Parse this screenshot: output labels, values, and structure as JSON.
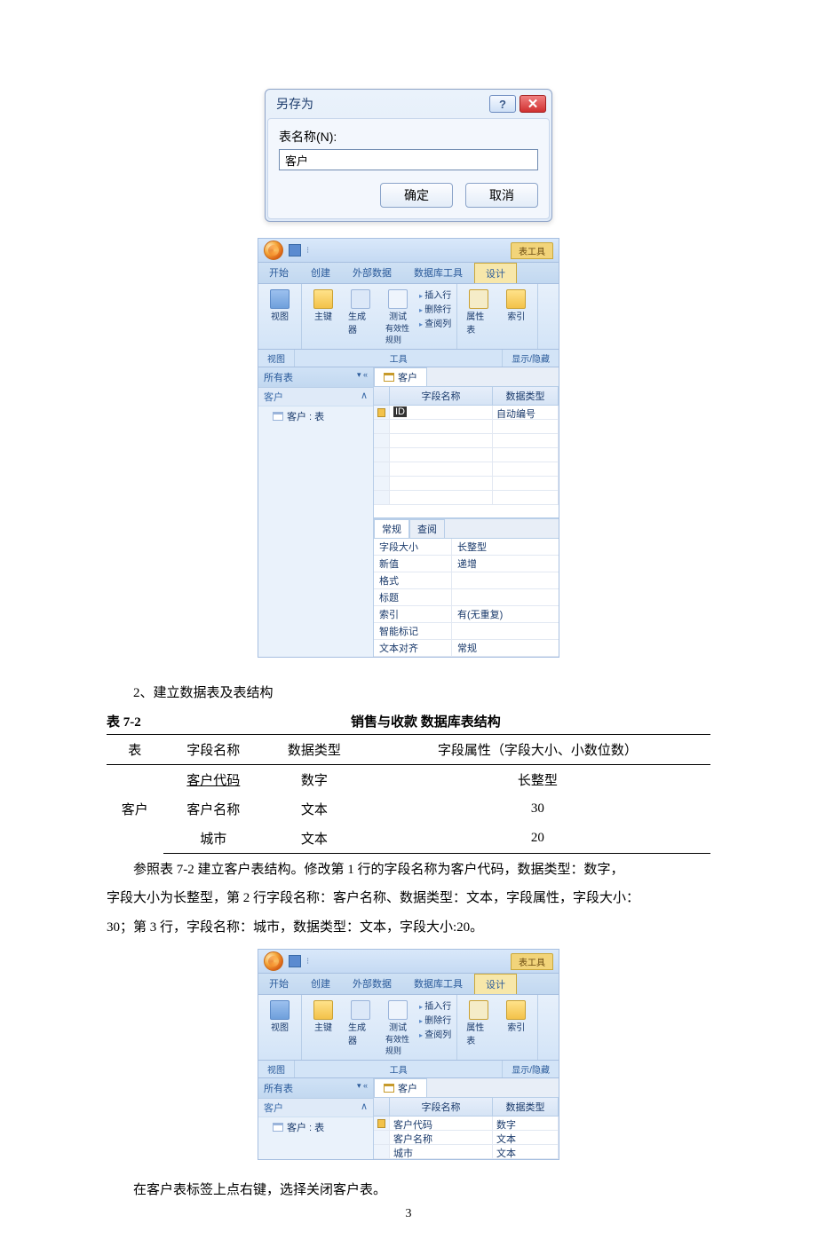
{
  "saveas": {
    "title": "另存为",
    "label": "表名称(N):",
    "value": "客户",
    "ok": "确定",
    "cancel": "取消"
  },
  "access1": {
    "context": "表工具",
    "tabs": {
      "start": "开始",
      "create": "创建",
      "external": "外部数据",
      "dbtools": "数据库工具",
      "design": "设计"
    },
    "ribbon": {
      "view": "视图",
      "key": "主键",
      "builder": "生成器",
      "test": "测试",
      "valid": "有效性规则",
      "insert": "插入行",
      "delete": "删除行",
      "lookup": "查阅列",
      "prop": "属性表",
      "index": "索引",
      "g_view": "视图",
      "g_tools": "工具",
      "g_show": "显示/隐藏"
    },
    "nav": {
      "all": "所有表",
      "group": "客户",
      "item": "客户 : 表"
    },
    "design": {
      "tab": "客户",
      "head_field": "字段名称",
      "head_type": "数据类型",
      "row1_field": "ID",
      "row1_type": "自动编号",
      "proptab1": "常规",
      "proptab2": "查阅",
      "props": [
        {
          "k": "字段大小",
          "v": "长整型"
        },
        {
          "k": "新值",
          "v": "递增"
        },
        {
          "k": "格式",
          "v": ""
        },
        {
          "k": "标题",
          "v": ""
        },
        {
          "k": "索引",
          "v": "有(无重复)"
        },
        {
          "k": "智能标记",
          "v": ""
        },
        {
          "k": "文本对齐",
          "v": "常规"
        }
      ]
    }
  },
  "doc": {
    "step2": "2、建立数据表及表结构",
    "tbl_num": "表 7-2",
    "tbl_title": "销售与收款 数据库表结构",
    "th": {
      "tbl": "表",
      "field": "字段名称",
      "type": "数据类型",
      "attr": "字段属性（字段大小、小数位数）"
    },
    "rows": {
      "name": "客户",
      "r1f": "客户代码",
      "r1t": "数字",
      "r1a": "长整型",
      "r2f": "客户名称",
      "r2t": "文本",
      "r2a": "30",
      "r3f": "城市",
      "r3t": "文本",
      "r3a": "20"
    },
    "para1": "参照表 7-2 建立客户表结构。修改第 1 行的字段名称为客户代码，数据类型：数字，",
    "para2": "字段大小为长整型，第 2 行字段名称：客户名称、数据类型：文本，字段属性，字段大小：",
    "para3": "30；第 3 行，字段名称：城市，数据类型：文本，字段大小:20。",
    "closeline": "在客户表标签上点右键，选择关闭客户表。"
  },
  "access2": {
    "rows": [
      {
        "f": "客户代码",
        "t": "数字"
      },
      {
        "f": "客户名称",
        "t": "文本"
      },
      {
        "f": "城市",
        "t": "文本"
      }
    ]
  },
  "page": "3"
}
